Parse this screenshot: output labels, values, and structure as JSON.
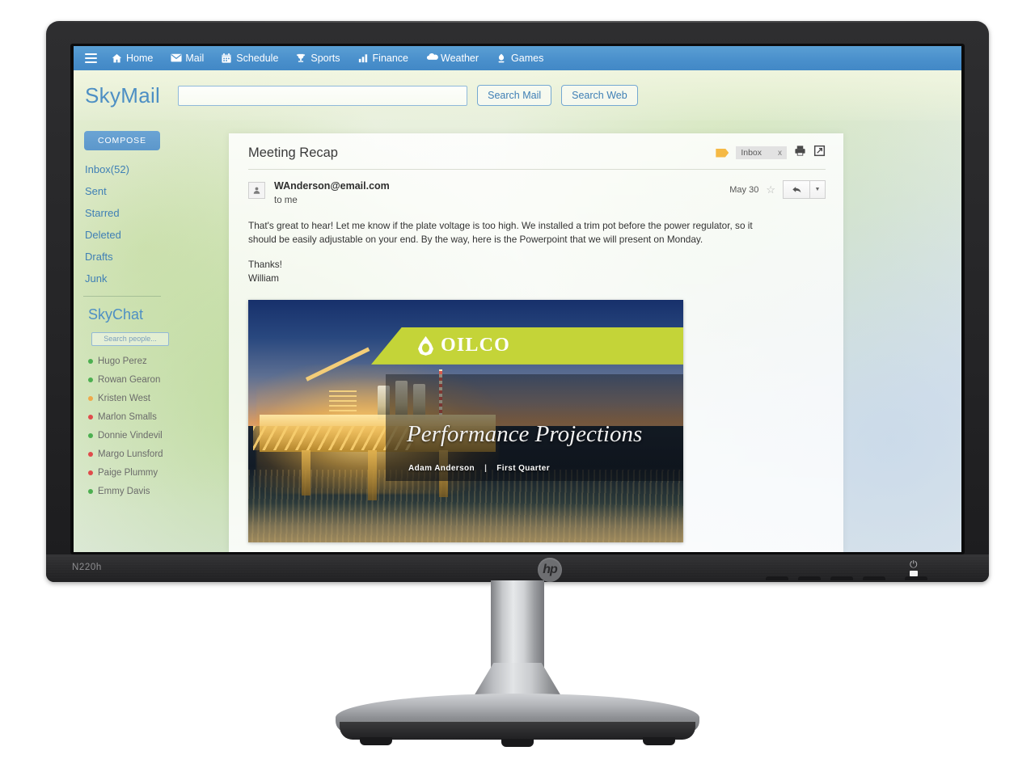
{
  "monitor": {
    "model_label": "N220h",
    "brand_logo": "hp",
    "power_icon": "⏻"
  },
  "topnav": {
    "menu_icon": "hamburger-icon",
    "items": [
      {
        "label": "Home",
        "icon": "home-icon"
      },
      {
        "label": "Mail",
        "icon": "envelope-icon"
      },
      {
        "label": "Schedule",
        "icon": "calendar-icon"
      },
      {
        "label": "Sports",
        "icon": "trophy-icon"
      },
      {
        "label": "Finance",
        "icon": "bar-chart-icon"
      },
      {
        "label": "Weather",
        "icon": "cloud-icon"
      },
      {
        "label": "Games",
        "icon": "gamepad-icon"
      }
    ]
  },
  "brandbar": {
    "brand": "SkyMail",
    "search_value": "",
    "search_placeholder": "",
    "search_mail_label": "Search Mail",
    "search_web_label": "Search Web"
  },
  "sidebar": {
    "compose_label": "COMPOSE",
    "folders": [
      {
        "label": "Inbox(52)"
      },
      {
        "label": "Sent"
      },
      {
        "label": "Starred"
      },
      {
        "label": "Deleted"
      },
      {
        "label": "Drafts"
      },
      {
        "label": "Junk"
      }
    ],
    "chat": {
      "title": "SkyChat",
      "search_placeholder": "Search people...",
      "search_value": "",
      "contacts": [
        {
          "name": "Hugo Perez",
          "status_color": "#4caf50"
        },
        {
          "name": "Rowan Gearon",
          "status_color": "#4caf50"
        },
        {
          "name": "Kristen West",
          "status_color": "#efa94a"
        },
        {
          "name": "Marlon Smalls",
          "status_color": "#e04b4b"
        },
        {
          "name": "Donnie Vindevil",
          "status_color": "#4caf50"
        },
        {
          "name": "Margo Lunsford",
          "status_color": "#e04b4b"
        },
        {
          "name": "Paige Plummy",
          "status_color": "#e04b4b"
        },
        {
          "name": "Emmy Davis",
          "status_color": "#4caf50"
        }
      ]
    }
  },
  "mail": {
    "subject": "Meeting Recap",
    "label_chip": "Inbox",
    "label_chip_close": "x",
    "tag_icon": "tag-icon",
    "print_icon": "printer-icon",
    "popout_icon": "open-in-new-window-icon",
    "sender": "WAnderson@email.com",
    "recipient": "to me",
    "date": "May 30",
    "star_icon": "☆",
    "reply_icon": "reply-arrow-icon",
    "reply_caret": "▼",
    "body_paragraph": "That's great to hear! Let me know if the plate voltage is too high. We installed a trim pot before the power regulator, so it should be easily adjustable on your end. By the way, here is the Powerpoint that we will present on Monday.",
    "closing": "Thanks!",
    "signature": "William"
  },
  "slide": {
    "logo_text": "OILCO",
    "logo_icon": "oil-droplet-icon",
    "title": "Performance Projections",
    "author": "Adam Anderson",
    "separator": "|",
    "quarter": "First Quarter",
    "accent_color": "#c4d438"
  }
}
